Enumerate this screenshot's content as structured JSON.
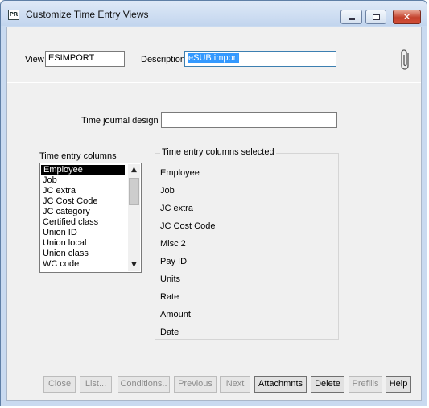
{
  "window": {
    "title": "Customize Time Entry Views",
    "app_icon_text": "PR",
    "controls": {
      "min": "minimize-icon",
      "max": "maximize-icon",
      "close": "close-icon",
      "close_glyph": "✕"
    }
  },
  "header": {
    "view_label": "View",
    "view_value": "ESIMPORT",
    "description_label": "Description",
    "description_value": "eSUB import",
    "attachment_icon": "paperclip-icon"
  },
  "design": {
    "label": "Time journal design",
    "value": ""
  },
  "columns_list": {
    "label": "Time entry columns",
    "items": [
      "Employee",
      "Job",
      "JC extra",
      "JC Cost Code",
      "JC category",
      "Certified class",
      "Union ID",
      "Union local",
      "Union class",
      "WC code"
    ],
    "selected_index": 0,
    "scroll_up": "▲",
    "scroll_down": "▼"
  },
  "selected_columns": {
    "label": "Time entry columns selected",
    "items": [
      "Employee",
      "Job",
      "JC extra",
      "JC Cost Code",
      "Misc 2",
      "Pay ID",
      "Units",
      "Rate",
      "Amount",
      "Date"
    ]
  },
  "buttons": [
    {
      "label": "Close",
      "enabled": false
    },
    {
      "label": "List...",
      "enabled": false
    },
    {
      "label": "Conditions..",
      "enabled": false
    },
    {
      "label": "Previous",
      "enabled": false
    },
    {
      "label": "Next",
      "enabled": false
    },
    {
      "label": "Attachmnts",
      "enabled": true
    },
    {
      "label": "Delete",
      "enabled": true
    },
    {
      "label": "Prefills",
      "enabled": false
    },
    {
      "label": "Help",
      "enabled": true
    }
  ]
}
